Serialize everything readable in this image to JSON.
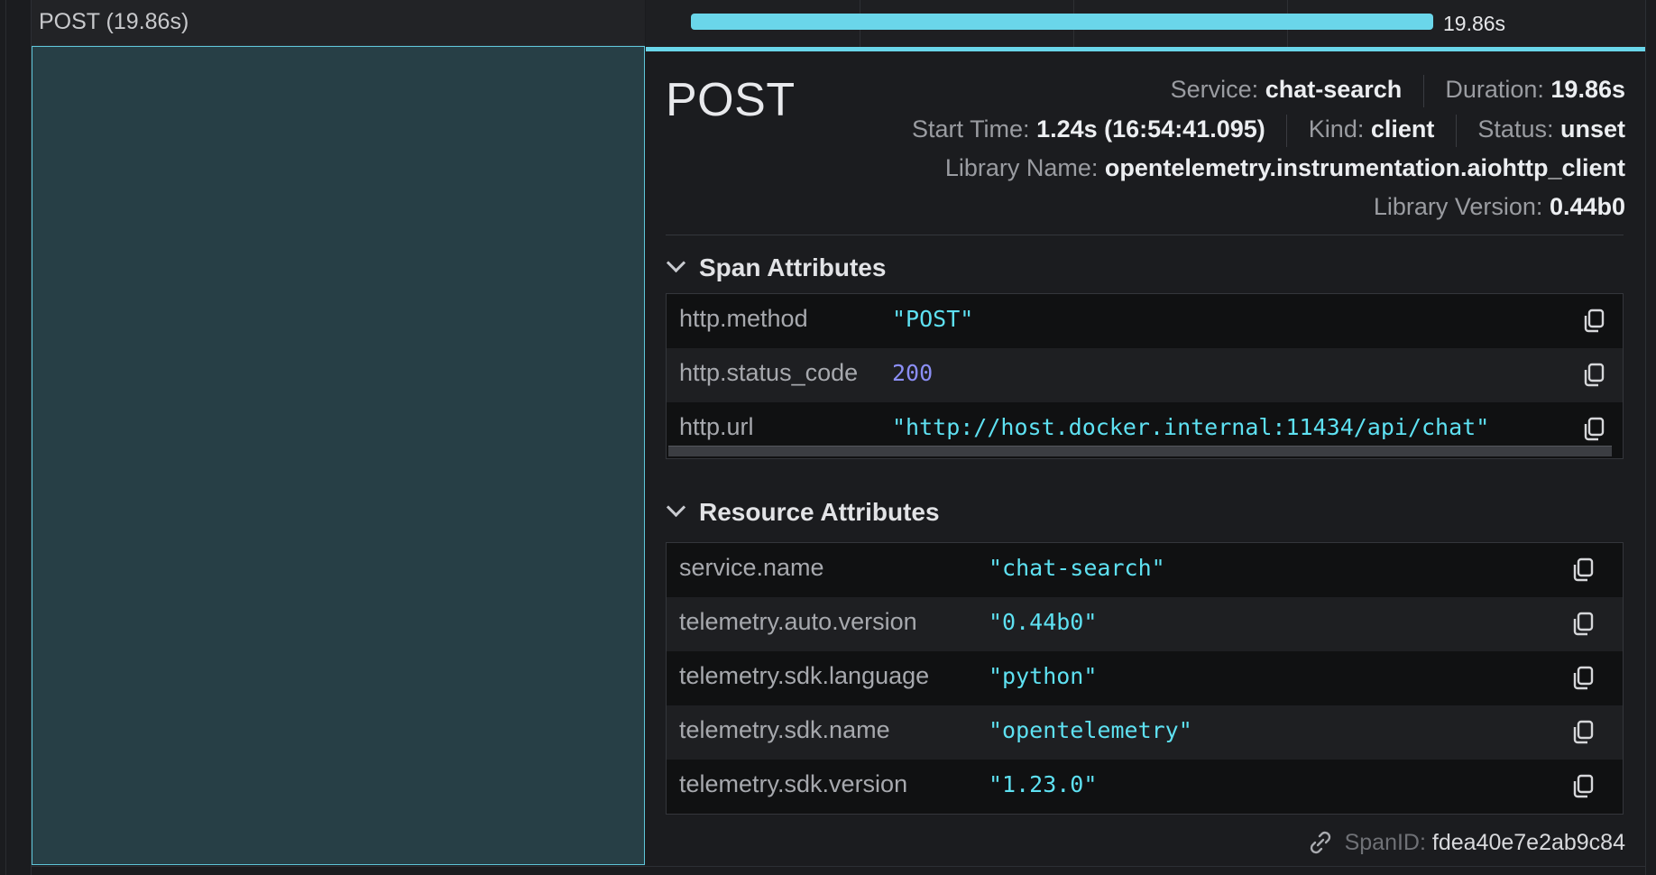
{
  "span_row": {
    "label": "POST (19.86s)"
  },
  "timeline": {
    "duration_label": "19.86s",
    "bar_fraction": 1.0
  },
  "details": {
    "operation": "POST",
    "service_label": "Service:",
    "service_value": "chat-search",
    "duration_label": "Duration:",
    "duration_value": "19.86s",
    "start_label": "Start Time:",
    "start_value": "1.24s (16:54:41.095)",
    "kind_label": "Kind:",
    "kind_value": "client",
    "status_label": "Status:",
    "status_value": "unset",
    "library_name_label": "Library Name:",
    "library_name_value": "opentelemetry.instrumentation.aiohttp_client",
    "library_version_label": "Library Version:",
    "library_version_value": "0.44b0"
  },
  "span_attributes": {
    "title": "Span Attributes",
    "rows": [
      {
        "key": "http.method",
        "value": "\"POST\""
      },
      {
        "key": "http.status_code",
        "value": "200"
      },
      {
        "key": "http.url",
        "value": "\"http://host.docker.internal:11434/api/chat\""
      }
    ]
  },
  "resource_attributes": {
    "title": "Resource Attributes",
    "rows": [
      {
        "key": "service.name",
        "value": "\"chat-search\""
      },
      {
        "key": "telemetry.auto.version",
        "value": "\"0.44b0\""
      },
      {
        "key": "telemetry.sdk.language",
        "value": "\"python\""
      },
      {
        "key": "telemetry.sdk.name",
        "value": "\"opentelemetry\""
      },
      {
        "key": "telemetry.sdk.version",
        "value": "\"1.23.0\""
      }
    ]
  },
  "footer": {
    "spanid_label": "SpanID:",
    "spanid_value": "fdea40e7e2ab9c84"
  },
  "icons": {
    "copy": "copy-icon",
    "link": "link-icon",
    "chevron": "chevron-down-icon"
  },
  "colors": {
    "accent": "#6ad6ea",
    "selected_bg": "#273f46",
    "string_value": "#5ee1f2",
    "number_value": "#8b8ef5"
  }
}
